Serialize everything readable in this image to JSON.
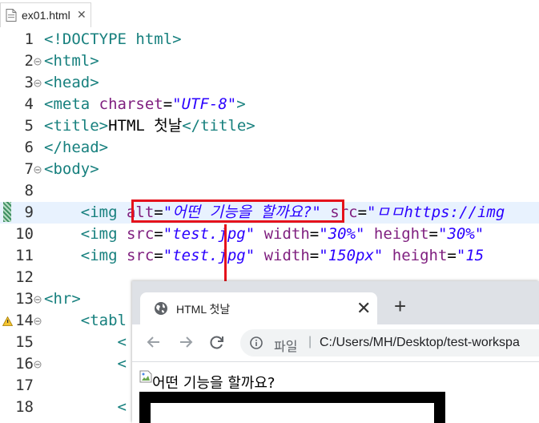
{
  "editor_tab": {
    "label": "ex01.html",
    "close": "✕"
  },
  "code_lines": [
    {
      "num": "1",
      "tokens": [
        {
          "c": "t-tag",
          "t": "<!DOCTYPE html>"
        }
      ]
    },
    {
      "num": "2",
      "fold": true,
      "tokens": [
        {
          "c": "t-tag",
          "t": "<html>"
        }
      ]
    },
    {
      "num": "3",
      "fold": true,
      "tokens": [
        {
          "c": "t-tag",
          "t": "<head>"
        }
      ]
    },
    {
      "num": "4",
      "tokens": [
        {
          "c": "t-tag",
          "t": "<meta "
        },
        {
          "c": "t-attr",
          "t": "charset"
        },
        {
          "c": "t-txt",
          "t": "="
        },
        {
          "c": "t-str",
          "t": "\"UTF-8\""
        },
        {
          "c": "t-tag",
          "t": ">"
        }
      ]
    },
    {
      "num": "5",
      "tokens": [
        {
          "c": "t-tag",
          "t": "<title>"
        },
        {
          "c": "t-txt",
          "t": "HTML 첫날"
        },
        {
          "c": "t-tag",
          "t": "</title>"
        }
      ]
    },
    {
      "num": "6",
      "tokens": [
        {
          "c": "t-tag",
          "t": "</head>"
        }
      ]
    },
    {
      "num": "7",
      "fold": true,
      "tokens": [
        {
          "c": "t-tag",
          "t": "<body>"
        }
      ]
    },
    {
      "num": "8",
      "tokens": []
    },
    {
      "num": "9",
      "current": true,
      "mark": true,
      "tokens": [
        {
          "c": "t-txt",
          "t": "    "
        },
        {
          "c": "t-tag",
          "t": "<img "
        },
        {
          "c": "t-attr",
          "t": "alt"
        },
        {
          "c": "t-txt",
          "t": "="
        },
        {
          "c": "t-str",
          "t": "\"어떤 기능을 할까요?\""
        },
        {
          "c": "t-txt",
          "t": " "
        },
        {
          "c": "t-attr",
          "t": "src"
        },
        {
          "c": "t-txt",
          "t": "="
        },
        {
          "c": "t-str",
          "t": "\"ㅁㅁhttps://img"
        }
      ]
    },
    {
      "num": "10",
      "tokens": [
        {
          "c": "t-txt",
          "t": "    "
        },
        {
          "c": "t-tag",
          "t": "<img "
        },
        {
          "c": "t-attr",
          "t": "src"
        },
        {
          "c": "t-txt",
          "t": "="
        },
        {
          "c": "t-str",
          "t": "\"test.jpg\""
        },
        {
          "c": "t-txt",
          "t": " "
        },
        {
          "c": "t-attr",
          "t": "width"
        },
        {
          "c": "t-txt",
          "t": "="
        },
        {
          "c": "t-str",
          "t": "\"30%\""
        },
        {
          "c": "t-txt",
          "t": " "
        },
        {
          "c": "t-attr",
          "t": "height"
        },
        {
          "c": "t-txt",
          "t": "="
        },
        {
          "c": "t-str",
          "t": "\"30%\""
        }
      ]
    },
    {
      "num": "11",
      "tokens": [
        {
          "c": "t-txt",
          "t": "    "
        },
        {
          "c": "t-tag",
          "t": "<img "
        },
        {
          "c": "t-attr",
          "t": "src"
        },
        {
          "c": "t-txt",
          "t": "="
        },
        {
          "c": "t-str",
          "t": "\"test.jpg\""
        },
        {
          "c": "t-txt",
          "t": " "
        },
        {
          "c": "t-attr",
          "t": "width"
        },
        {
          "c": "t-txt",
          "t": "="
        },
        {
          "c": "t-str",
          "t": "\"150px\""
        },
        {
          "c": "t-txt",
          "t": " "
        },
        {
          "c": "t-attr",
          "t": "height"
        },
        {
          "c": "t-txt",
          "t": "="
        },
        {
          "c": "t-str",
          "t": "\"15"
        }
      ]
    },
    {
      "num": "12",
      "tokens": []
    },
    {
      "num": "13",
      "fold": true,
      "tokens": [
        {
          "c": "t-tag",
          "t": "<hr>"
        }
      ]
    },
    {
      "num": "14",
      "fold": true,
      "warn": true,
      "tokens": [
        {
          "c": "t-txt",
          "t": "    "
        },
        {
          "c": "t-tag",
          "t": "<tabl"
        }
      ]
    },
    {
      "num": "15",
      "tokens": [
        {
          "c": "t-txt",
          "t": "        "
        },
        {
          "c": "t-tag",
          "t": "<"
        }
      ]
    },
    {
      "num": "16",
      "fold": true,
      "tokens": [
        {
          "c": "t-txt",
          "t": "        "
        },
        {
          "c": "t-tag",
          "t": "<"
        }
      ]
    },
    {
      "num": "17",
      "tokens": []
    },
    {
      "num": "18",
      "tokens": [
        {
          "c": "t-txt",
          "t": "        "
        },
        {
          "c": "t-tag",
          "t": "<"
        }
      ]
    }
  ],
  "browser": {
    "tab_title": "HTML 첫날",
    "tab_close": "✕",
    "new_tab": "+",
    "scheme_label": "파일",
    "separator": "|",
    "url": "C:/Users/MH/Desktop/test-workspa",
    "alt_text": "어떤 기능을 할까요?"
  },
  "colors": {
    "highlight": "#e5121b",
    "tag": "#17807e",
    "attribute": "#7f1f7f",
    "string": "#2a00ff"
  }
}
